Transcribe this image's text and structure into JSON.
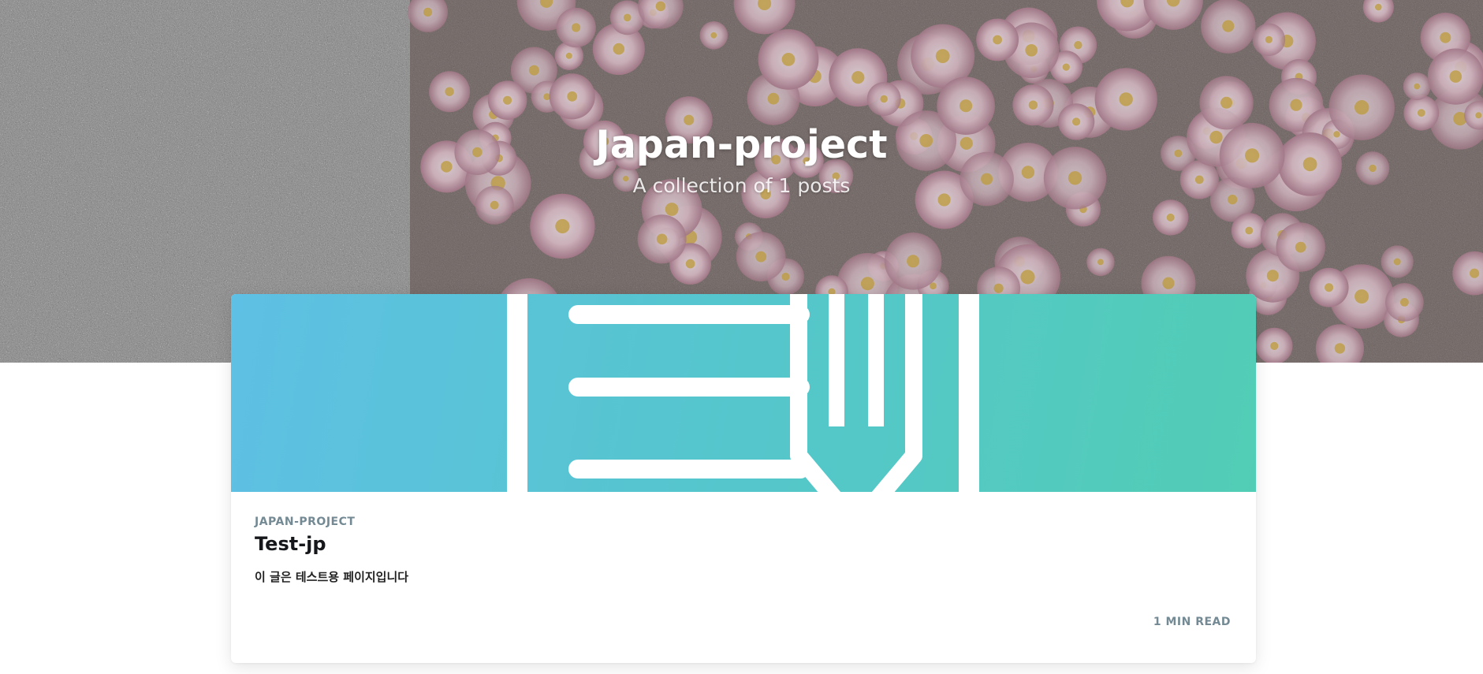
{
  "hero": {
    "title": "Japan-project",
    "subtitle": "A collection of 1 posts"
  },
  "post": {
    "tag": "JAPAN-PROJECT",
    "title": "Test-jp",
    "excerpt": "이 글은 테스트용 페이지입니다",
    "read_time": "1 MIN READ",
    "image_icon": "document-pencil-icon"
  },
  "colors": {
    "card_gradient_start": "#5ec0e4",
    "card_gradient_end": "#52cdb5",
    "meta_text": "#738a94",
    "title_text": "#15171a"
  }
}
